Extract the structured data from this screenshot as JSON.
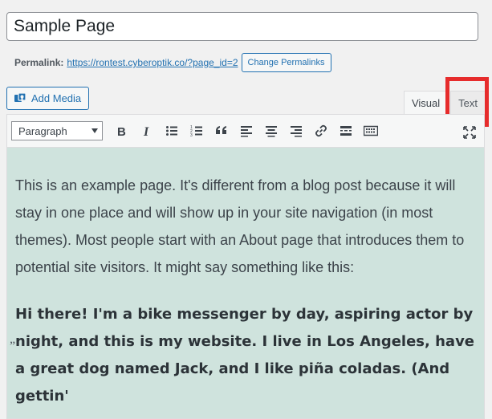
{
  "title": {
    "value": "Sample Page"
  },
  "permalink": {
    "label": "Permalink:",
    "url": "https://rontest.cyberoptik.co/?page_id=2",
    "change_button": "Change Permalinks"
  },
  "media": {
    "add_media_label": "Add Media"
  },
  "tabs": {
    "visual": "Visual",
    "text": "Text"
  },
  "toolbar": {
    "format_select": "Paragraph",
    "buttons": [
      "bold",
      "italic",
      "bulleted-list",
      "numbered-list",
      "blockquote",
      "align-left",
      "align-center",
      "align-right",
      "insert-link",
      "read-more",
      "toolbar-toggle",
      "fullscreen"
    ]
  },
  "content": {
    "paragraph1": "This is an example page. It's different from a blog post because it will stay in one place and will show up in your site navigation (in most themes). Most people start with an About page that introduces them to potential site visitors. It might say something like this:",
    "quote_marker": "”",
    "paragraph2": "Hi there! I'm a bike messenger by day, aspiring actor by night, and this is my website. I live in Los Angeles, have a great dog named Jack, and I like piña coladas. (And gettin'"
  },
  "colors": {
    "accent": "#2271b1",
    "highlight": "#e62c2c",
    "editor_bg": "#cfe3dd"
  }
}
